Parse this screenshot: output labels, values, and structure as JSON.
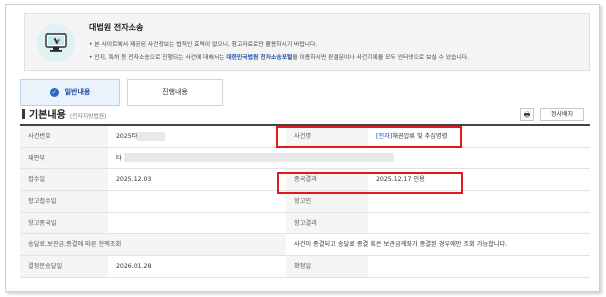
{
  "notice": {
    "title": "대법원 전자소송",
    "line1": "• 본 사이트에서 제공된 사건정보는 법적인 효력이 없으니, 참고자료로만 활용하시기 바랍니다.",
    "line2_prefix": "• 인지, 특허 등 전자소송으로 진행되는 사건에 대해서는 ",
    "line2_link": "대한민국법원 전자소송포털",
    "line2_suffix": "을 이용하시면 판결문이나 사건기록을 모두 인터넷으로 보실 수 있습니다."
  },
  "tabs": [
    {
      "label": "일반내용",
      "active": true
    },
    {
      "label": "진행내용",
      "active": false
    }
  ],
  "section": {
    "title": "기본내용",
    "subtitle": "(전자지방법원)"
  },
  "buttons": {
    "print": "🖶",
    "sort": "정사배치"
  },
  "table": {
    "case_no_label": "사건번호",
    "case_no_value": "2025타",
    "case_name_label": "사건명",
    "case_name_tag": "[전자]",
    "case_name_value": "채권압류 및 추심명령",
    "court_label": "재판부",
    "court_value": "타",
    "receipt_label": "접수일",
    "receipt_value": "2025.12.03",
    "result_label": "종국결과",
    "result_value": "2025.12.17 인용",
    "appeal_receipt_label": "항고접수일",
    "appellant_label": "항고인",
    "appeal_end_label": "항고종국일",
    "appeal_result_label": "항고결과",
    "deposit_label": "송달료,보관금,종결에 따른 잔액조회",
    "deposit_msg": "사건이 종결되고 송달료 종결 혹은 보관금계좌가 종결된 경우에만 조회 가능합니다.",
    "decision_label": "결정문송달일",
    "decision_value": "2026.01.28",
    "finalized_label": "확정일"
  },
  "colors": {
    "accent": "#1d4fa3",
    "highlight": "#e0191f",
    "tab_active_bg": "#eaf2fb"
  }
}
